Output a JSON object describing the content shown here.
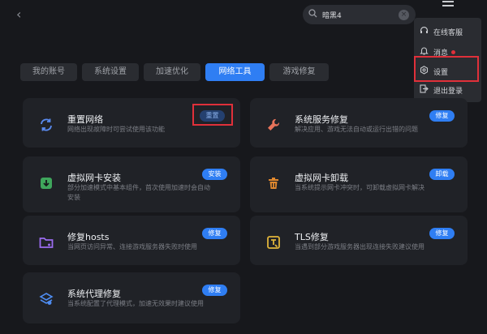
{
  "search": {
    "value": "暗黑4",
    "clear_glyph": "×"
  },
  "dropdown": {
    "items": [
      {
        "icon": "headset-icon",
        "label": "在线客服"
      },
      {
        "icon": "bell-icon",
        "label": "消息",
        "has_dot": true
      },
      {
        "icon": "gear-icon",
        "label": "设置"
      },
      {
        "icon": "logout-icon",
        "label": "退出登录"
      }
    ]
  },
  "tabs": [
    {
      "label": "我的账号",
      "active": false
    },
    {
      "label": "系统设置",
      "active": false
    },
    {
      "label": "加速优化",
      "active": false
    },
    {
      "label": "网络工具",
      "active": true
    },
    {
      "label": "游戏修复",
      "active": false
    }
  ],
  "cards": {
    "reset_network": {
      "title": "重置网络",
      "desc": "网络出现故障时可尝试使用该功能",
      "button": "重置",
      "icon": "refresh-icon"
    },
    "service_repair": {
      "title": "系统服务修复",
      "desc": "解决应用、游戏无法自动或运行出错的问题",
      "button": "修复",
      "icon": "wrench-icon"
    },
    "vnic_install": {
      "title": "虚拟网卡安装",
      "desc": "部分加速模式中基本组件，首次使用加速时会自动安装",
      "button": "安装",
      "icon": "download-icon"
    },
    "vnic_uninstall": {
      "title": "虚拟网卡卸载",
      "desc": "当系统提示网卡冲突时，可卸载虚拟网卡解决",
      "button": "卸载",
      "icon": "trash-icon"
    },
    "hosts_repair": {
      "title": "修复hosts",
      "desc": "当网页访问异常、连接游戏服务器失败时使用",
      "button": "修复",
      "icon": "folder-icon"
    },
    "tls_repair": {
      "title": "TLS修复",
      "desc": "当遇到部分游戏服务器出现连接失败建议使用",
      "button": "修复",
      "icon": "tls-icon"
    },
    "proxy_repair": {
      "title": "系统代理修复",
      "desc": "当系统配置了代理模式，加速无效果时建议使用",
      "button": "修复",
      "icon": "layers-icon"
    }
  },
  "colors": {
    "accent": "#2f7ef3",
    "highlight": "#e0303a",
    "background": "#17181c",
    "card": "#202227"
  }
}
